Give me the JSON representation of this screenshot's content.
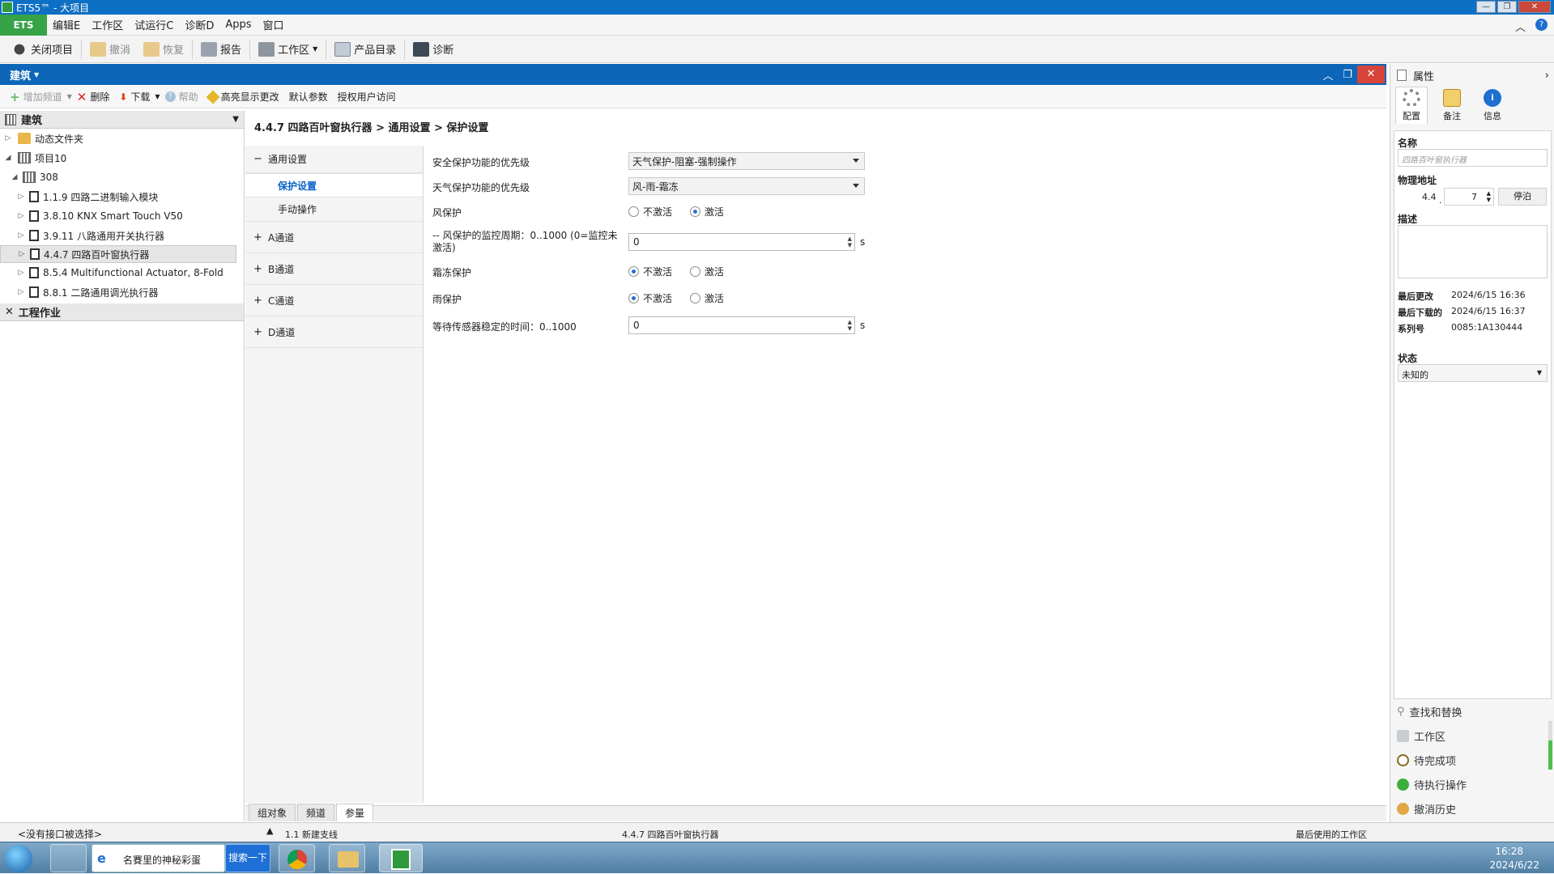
{
  "window": {
    "title": "ETS5™ - 大项目"
  },
  "menu": {
    "brand": "ETS",
    "items": [
      "编辑E",
      "工作区",
      "试运行C",
      "诊断D",
      "Apps",
      "窗口"
    ]
  },
  "toolbar": {
    "close_project": "关闭项目",
    "undo": "撤消",
    "redo": "恢复",
    "report": "报告",
    "workspace": "工作区",
    "catalog": "产品目录",
    "diagnostics": "诊断"
  },
  "panel": {
    "title": "建筑"
  },
  "toolbar2": {
    "add_channel": "增加频道",
    "delete": "删除",
    "download": "下载",
    "help": "帮助",
    "highlight": "高亮显示更改",
    "default_params": "默认参数",
    "authorize": "授权用户访问"
  },
  "tree": {
    "header": "建筑",
    "nodes": [
      {
        "label": "动态文件夹"
      },
      {
        "label": "项目10"
      },
      {
        "label": "308"
      },
      {
        "label": "1.1.9 四路二进制输入模块"
      },
      {
        "label": "3.8.10 KNX Smart Touch V50"
      },
      {
        "label": "3.9.11 八路通用开关执行器"
      },
      {
        "label": "4.4.7 四路百叶窗执行器"
      },
      {
        "label": "8.5.4 Multifunctional Actuator, 8-Fold"
      },
      {
        "label": "8.8.1 二路通用调光执行器"
      }
    ],
    "footer": "工程作业"
  },
  "breadcrumb": "4.4.7 四路百叶窗执行器 > 通用设置 > 保护设置",
  "nav": {
    "general": "通用设置",
    "protection": "保护设置",
    "manual": "手动操作",
    "channels": [
      "A通道",
      "B通道",
      "C通道",
      "D通道"
    ]
  },
  "params": {
    "safety_priority_label": "安全保护功能的优先级",
    "safety_priority_value": "天气保护-阻塞-强制操作",
    "weather_priority_label": "天气保护功能的优先级",
    "weather_priority_value": "风-雨-霜冻",
    "wind_label": "风保护",
    "opt_off": "不激活",
    "opt_on": "激活",
    "wind_period_label": "-- 风保护的监控周期：0..1000 (0=监控未激活)",
    "wind_period_value": "0",
    "unit": "s",
    "frost_label": "霜冻保护",
    "rain_label": "雨保护",
    "sensor_wait_label": "等待传感器稳定的时间：0..1000",
    "sensor_wait_value": "0"
  },
  "bottom_tabs": [
    "组对象",
    "频道",
    "参量"
  ],
  "status": {
    "interface": "<没有接口被选择>",
    "line": "1.1 新建支线",
    "device": "4.4.7 四路百叶窗执行器",
    "recent": "最后使用的工作区"
  },
  "properties": {
    "title": "属性",
    "tabs": [
      "配置",
      "备注",
      "信息"
    ],
    "name_label": "名称",
    "name_placeholder": "四路百叶窗执行器",
    "phys_label": "物理地址",
    "phys_prefix": "4.4",
    "phys_suffix": "7",
    "park_button": "停泊",
    "desc_label": "描述",
    "last_modified_label": "最后更改",
    "last_modified": "2024/6/15 16:36",
    "last_download_label": "最后下载的",
    "last_download": "2024/6/15 16:37",
    "serial_label": "系列号",
    "serial": "0085:1A130444",
    "state_label": "状态",
    "state_value": "未知的",
    "links": [
      "查找和替换",
      "工作区",
      "待完成项",
      "待执行操作",
      "撤消历史"
    ]
  },
  "taskbar": {
    "ie_title": "名賽里的神秘彩蛋",
    "search_btn": "搜索一下",
    "time": "16:28",
    "date": "2024/6/22"
  }
}
